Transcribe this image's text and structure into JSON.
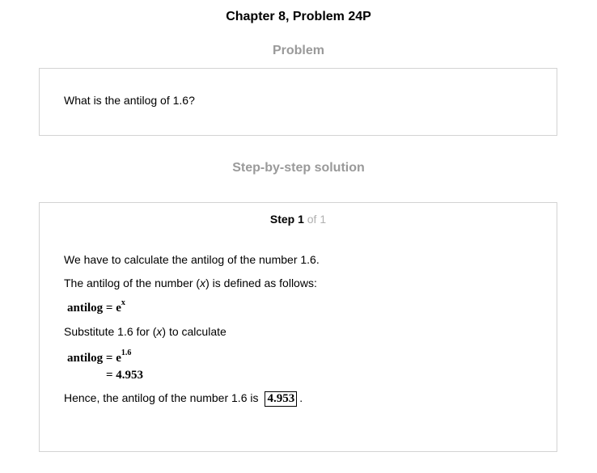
{
  "header": {
    "chapter_title": "Chapter 8, Problem 24P"
  },
  "problem": {
    "heading": "Problem",
    "text": "What is the antilog of 1.6?"
  },
  "solution": {
    "heading": "Step-by-step solution",
    "step_label": "Step 1",
    "step_of": " of 1",
    "line1": "We have to calculate the antilog of the number 1.6.",
    "line2_before": "The antilog of the number (",
    "line2_var": "x",
    "line2_after": ") is defined as follows:",
    "eq1_lhs": "antilog = e",
    "eq1_exp": "x",
    "line3_before": "Substitute 1.6 for (",
    "line3_var": "x",
    "line3_after": ") to calculate",
    "eq2_lhs": "antilog = e",
    "eq2_exp": "1.6",
    "eq2_result": "= 4.953",
    "conclusion": "Hence, the antilog of the number 1.6 is",
    "answer": "4.953",
    "final_period": "."
  }
}
